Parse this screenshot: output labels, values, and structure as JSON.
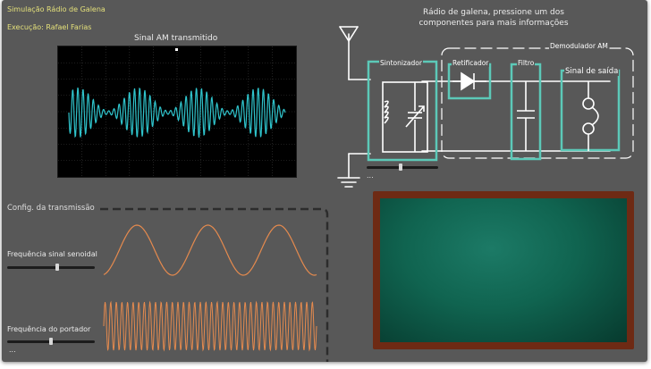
{
  "header": {
    "app_title": "Simulação Rádio de Galena",
    "author": "Execução: Rafael Farias"
  },
  "scope": {
    "title": "Sinal AM transmitido"
  },
  "circuit": {
    "instruction_line1": "Rádio de galena, pressione um dos",
    "instruction_line2": "componentes para mais informações",
    "tuner_label": "Sintonizador",
    "rectifier_label": "Retificador",
    "filter_label": "Filtro",
    "demodulator_label": "Demodulador AM",
    "output_label": "Sinal de saída",
    "tuner_slider_more": "...",
    "tuner_slider_level": 0.47
  },
  "transmission": {
    "section_title": "Config. da transmissão",
    "sine_freq_label": "Frequência sinal senoidal",
    "carrier_freq_label": "Frequência do portador",
    "sine_slider_level": 0.57,
    "carrier_slider_level": 0.5,
    "carrier_more": "..."
  },
  "colors": {
    "background": "#585858",
    "am_signal": "#2fc4cc",
    "sine_wave": "#e58a4e",
    "component_highlight": "#5cc9b8",
    "chalkboard": "#106450",
    "chalkboard_frame": "#6e2a14"
  }
}
